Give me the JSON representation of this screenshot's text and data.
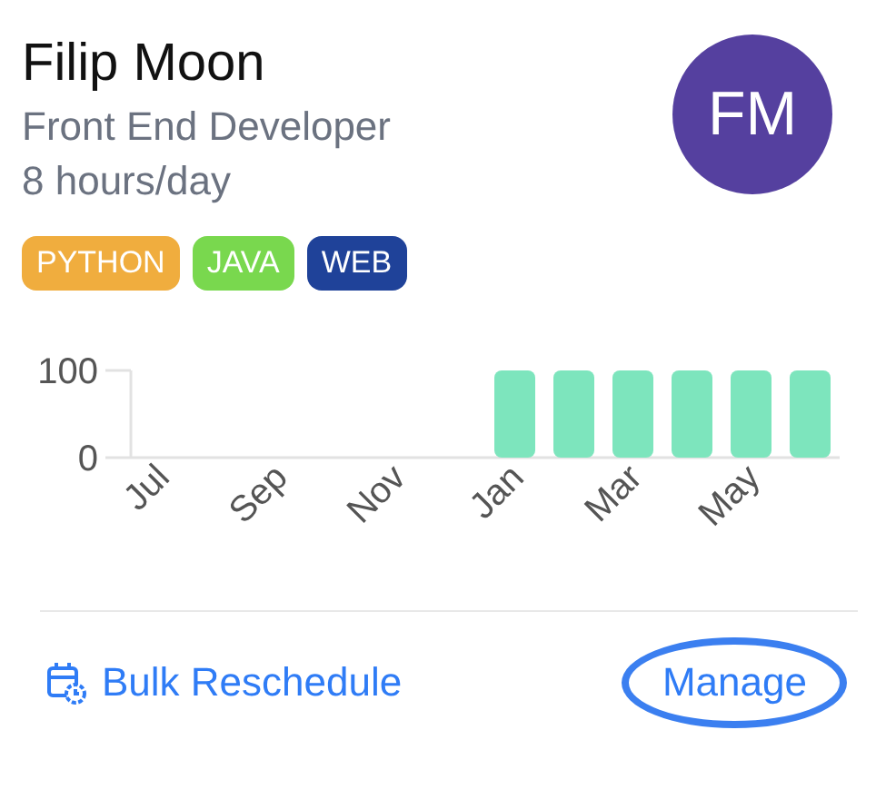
{
  "profile": {
    "name": "Filip Moon",
    "role": "Front End Developer",
    "hours": "8 hours/day",
    "initials": "FM"
  },
  "tags": [
    {
      "label": "PYTHON",
      "color": "#f0ad3e"
    },
    {
      "label": "JAVA",
      "color": "#79d84e"
    },
    {
      "label": "WEB",
      "color": "#1f4299"
    }
  ],
  "chart_data": {
    "type": "bar",
    "categories": [
      "Jul",
      null,
      "Sep",
      null,
      "Nov",
      null,
      "Jan",
      null,
      "Mar",
      null,
      "May",
      null
    ],
    "values": [
      0,
      0,
      0,
      0,
      0,
      0,
      100,
      100,
      100,
      100,
      100,
      100
    ],
    "ylim": [
      0,
      100
    ],
    "yticks": [
      0,
      100
    ]
  },
  "footer": {
    "reschedule": "Bulk Reschedule",
    "manage": {
      "label": "Manage",
      "focused": true
    }
  }
}
